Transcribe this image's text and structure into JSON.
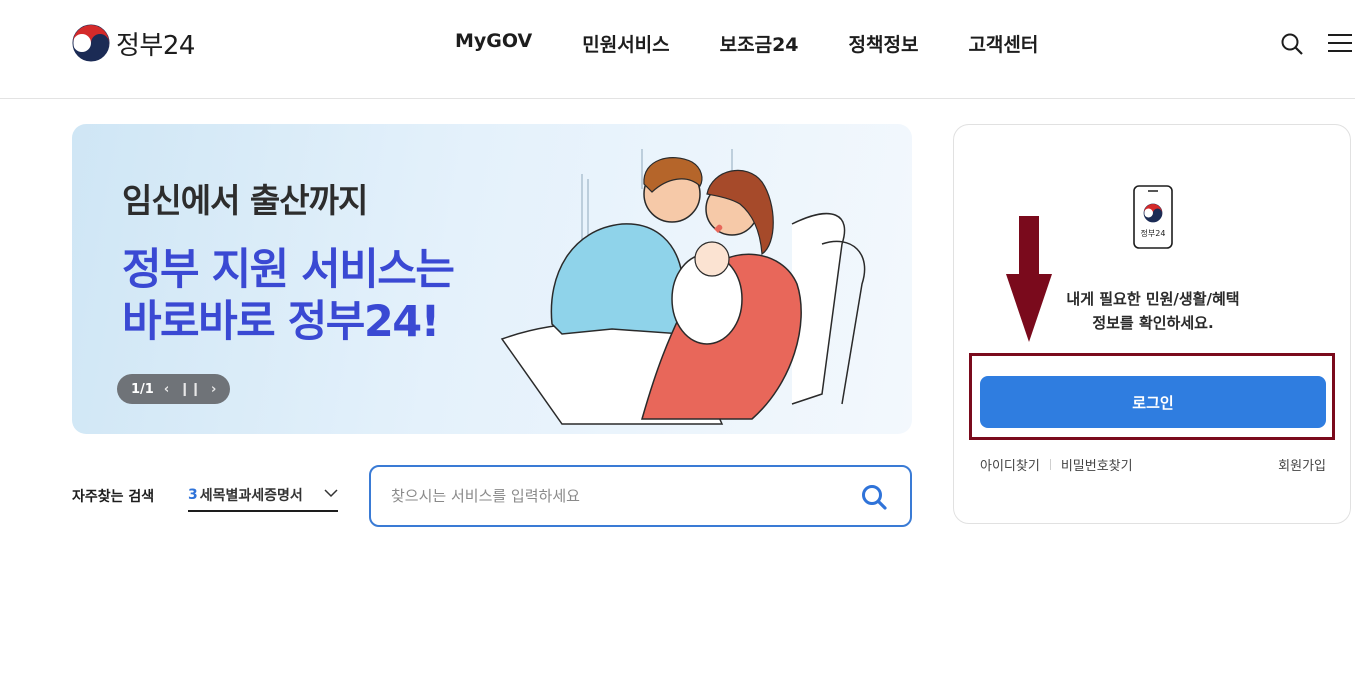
{
  "header": {
    "logo_text": "정부24",
    "nav": [
      "MyGOV",
      "민원서비스",
      "보조금24",
      "정책정보",
      "고객센터"
    ],
    "search_icon": "search-icon",
    "menu_icon": "hamburger-menu-icon"
  },
  "banner": {
    "subtitle": "임신에서 출산까지",
    "title_line1": "정부 지원 서비스는",
    "title_line2": "바로바로 정부24!",
    "pager": "1/1",
    "prev_icon": "chevron-left-icon",
    "pause_icon": "pause-icon",
    "next_icon": "chevron-right-icon"
  },
  "frequent_search": {
    "label": "자주찾는 검색",
    "selected_rank": "3",
    "selected_text": "세목별과세증명서"
  },
  "search": {
    "placeholder": "찾으시는 서비스를 입력하세요"
  },
  "login_card": {
    "message_line1": "내게 필요한 민원/생활/혜택",
    "message_line2": "정보를 확인하세요.",
    "phone_label": "정부24",
    "login_button": "로그인",
    "find_id": "아이디찾기",
    "find_password": "비밀번호찾기",
    "signup": "회원가입"
  },
  "colors": {
    "accent_blue": "#2f7de0",
    "banner_title": "#3a49d3",
    "highlight_box": "#7a0a1c",
    "arrow": "#7a0a1c"
  }
}
